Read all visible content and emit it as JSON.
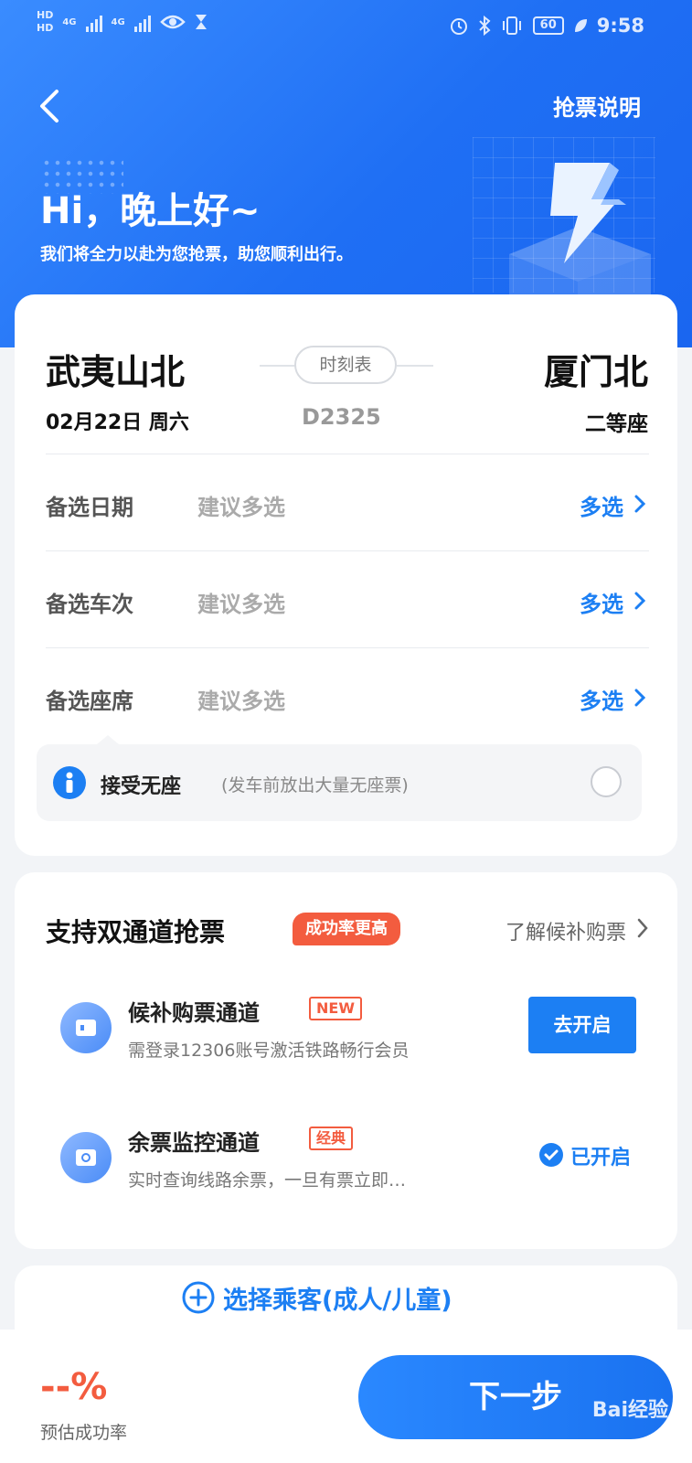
{
  "status_bar": {
    "hd_top": "HD",
    "hd_bottom": "HD",
    "net1": "4G",
    "net2": "4G",
    "battery": "60",
    "time": "9:58"
  },
  "header": {
    "guide_label": "抢票说明",
    "greeting": "Hi，晚上好~",
    "subtitle": "我们将全力以赴为您抢票，助您顺利出行。"
  },
  "trip": {
    "from_station": "武夷山北",
    "to_station": "厦门北",
    "timetable_label": "时刻表",
    "date": "02月22日 周六",
    "train_no": "D2325",
    "seat_class": "二等座"
  },
  "options": [
    {
      "label": "备选日期",
      "hint": "建议多选",
      "action": "多选"
    },
    {
      "label": "备选车次",
      "hint": "建议多选",
      "action": "多选"
    },
    {
      "label": "备选座席",
      "hint": "建议多选",
      "action": "多选"
    }
  ],
  "no_seat": {
    "title": "接受无座",
    "note": "(发车前放出大量无座票)"
  },
  "channels": {
    "title": "支持双通道抢票",
    "badge": "成功率更高",
    "learn_more": "了解候补购票",
    "items": [
      {
        "name": "候补购票通道",
        "tag": "NEW",
        "desc": "需登录12306账号激活铁路畅行会员",
        "button": "去开启"
      },
      {
        "name": "余票监控通道",
        "tag": "经典",
        "desc": "实时查询线路余票，一旦有票立即…",
        "status": "已开启"
      }
    ]
  },
  "passengers": {
    "add_label": "选择乘客(成人/儿童)"
  },
  "footer": {
    "success_rate": "--%",
    "success_label": "预估成功率",
    "next_label": "下一步",
    "watermark": "Bai经验"
  },
  "colors": {
    "primary": "#1c7ff3",
    "accent": "#f35c3f",
    "header_bg": "#2a7df8"
  }
}
